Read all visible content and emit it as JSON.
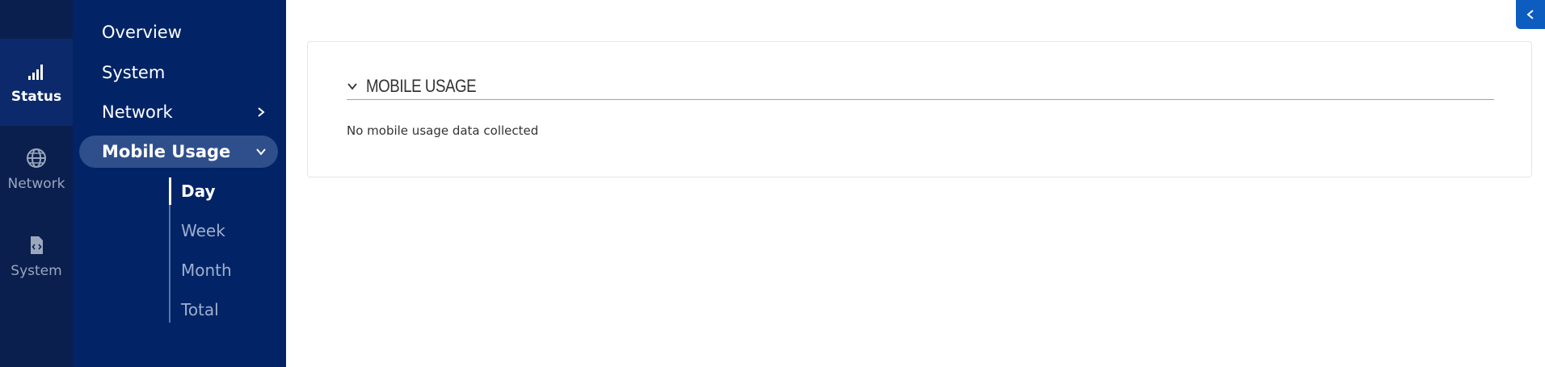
{
  "rail": {
    "items": [
      {
        "label": "Status",
        "icon": "signal-bars-icon",
        "active": true
      },
      {
        "label": "Network",
        "icon": "globe-icon",
        "active": false
      },
      {
        "label": "System",
        "icon": "code-file-icon",
        "active": false
      }
    ]
  },
  "subnav": {
    "items": [
      {
        "label": "Overview"
      },
      {
        "label": "System"
      },
      {
        "label": "Network",
        "icon": "chevron-right-icon"
      },
      {
        "label": "Mobile Usage",
        "icon": "chevron-down-icon",
        "expanded": true
      }
    ],
    "subitems": [
      {
        "label": "Day",
        "active": true
      },
      {
        "label": "Week"
      },
      {
        "label": "Month"
      },
      {
        "label": "Total"
      }
    ]
  },
  "main": {
    "section_title": "MOBILE USAGE",
    "empty_message": "No mobile usage data collected",
    "collapse_icon": "chevron-left-icon"
  },
  "colors": {
    "rail_bg": "#0a1f4d",
    "subnav_bg": "#022466",
    "accent": "#0d5cbf"
  }
}
